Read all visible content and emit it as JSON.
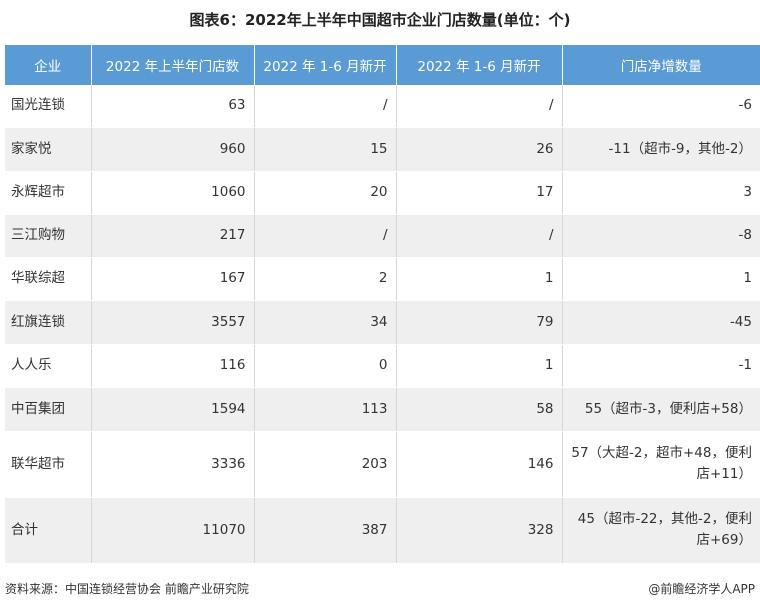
{
  "chart_data": {
    "type": "table",
    "title": "图表6：2022年上半年中国超市企业门店数量(单位：个)",
    "columns": [
      "企业",
      "2022 年上半年门店数",
      "2022 年 1-6 月新开",
      "2022 年 1-6 月新开",
      "门店净增数量"
    ],
    "rows": [
      [
        "国光连锁",
        "63",
        "/",
        "/",
        "-6"
      ],
      [
        "家家悦",
        "960",
        "15",
        "26",
        "-11（超市-9，其他-2）"
      ],
      [
        "永辉超市",
        "1060",
        "20",
        "17",
        "3"
      ],
      [
        "三江购物",
        "217",
        "/",
        "/",
        "-8"
      ],
      [
        "华联综超",
        "167",
        "2",
        "1",
        "1"
      ],
      [
        "红旗连锁",
        "3557",
        "34",
        "79",
        "-45"
      ],
      [
        "人人乐",
        "116",
        "0",
        "1",
        "-1"
      ],
      [
        "中百集团",
        "1594",
        "113",
        "58",
        "55（超市-3，便利店+58）"
      ],
      [
        "联华超市",
        "3336",
        "203",
        "146",
        "57（大超-2，超市+48，便利店+11）"
      ],
      [
        "合计",
        "11070",
        "387",
        "328",
        "45（超市-22，其他-2，便利店+69）"
      ]
    ]
  },
  "footer": {
    "source": "资料来源：中国连锁经营协会 前瞻产业研究院",
    "credit": "@前瞻经济学人APP"
  }
}
